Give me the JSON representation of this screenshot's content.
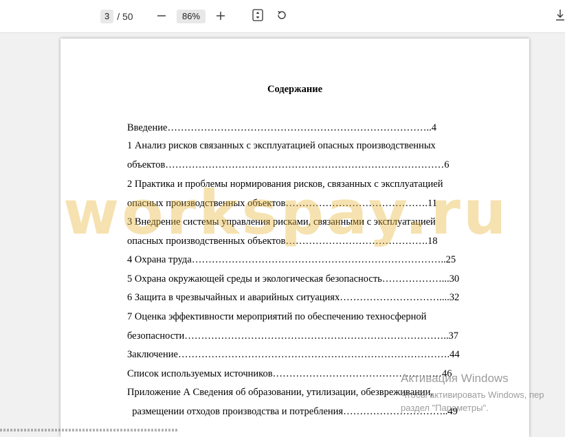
{
  "toolbar": {
    "current_page": "3",
    "total_pages": "/ 50",
    "zoom": "86%",
    "icons": {
      "zoom_out": "minus-icon",
      "zoom_in": "plus-icon",
      "fit": "fit-page-icon",
      "rotate": "rotate-icon",
      "download": "download-icon"
    }
  },
  "document": {
    "title": "Содержание",
    "lines": [
      "Введение……………………………………………………………………..4",
      "1 Анализ рисков связанных с эксплуатацией опасных производственных",
      "объектов…………………………………………………………………………6",
      "2 Практика и проблемы нормирования рисков, связанных с эксплуатацией",
      "опасных производственных объектов…………………………………….11",
      "3 Внедрение системы управления рисками, связанными с эксплуатацией",
      "опасных производственных объектов…………………………………….18",
      "4 Охрана труда…………………………………………………………………..25",
      "5 Охрана окружающей среды и экологическая безопасность………………...30",
      "6 Защита в чрезвычайных и аварийных ситуациях…………………………....32",
      "7 Оценка эффективности мероприятий по обеспечению техносферной",
      "безопасности……………………………………………………………………..37",
      "Заключение……………………………………………………………………….44",
      "Список используемых источников……………………………………………46",
      "Приложение А Сведения об образовании, утилизации, обезвреживании,",
      "  размещении отходов производства и потребления…………………………..49"
    ]
  },
  "watermark": "workspay.ru",
  "activation": {
    "title": "Активация Windows",
    "text": "Чтобы активировать Windows, пер\nраздел \"Параметры\"."
  }
}
